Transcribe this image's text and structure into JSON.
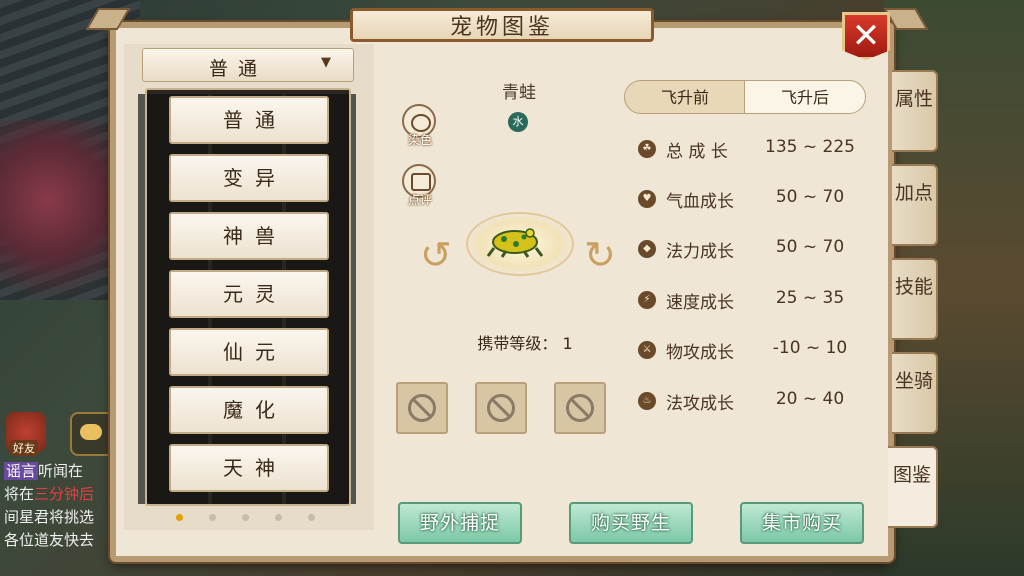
{
  "window": {
    "title": "宠物图鉴",
    "close_glyph": "✕"
  },
  "chat": {
    "friend_label": "好友",
    "lines": [
      {
        "tag": "谣言",
        "text": "听闻在"
      },
      {
        "pre": "将在",
        "red": "三分钟后"
      },
      {
        "text": "间星君将挑选"
      },
      {
        "text": "各位道友快去"
      }
    ]
  },
  "category": {
    "selected": "普通",
    "arrow": "▼",
    "options": [
      "普通",
      "变异",
      "神兽",
      "元灵",
      "仙元",
      "魔化",
      "天神"
    ]
  },
  "pet": {
    "name": "青蛙",
    "element": "水",
    "dye_label": "染色",
    "review_label": "点评",
    "carry_level_label": "携带等级：",
    "carry_level": "1"
  },
  "ascension_tabs": {
    "before": "飞升前",
    "after": "飞升后",
    "active": "before"
  },
  "stats": [
    {
      "name": "总 成 长",
      "value": "135 ~ 225",
      "icon": "growth-icon"
    },
    {
      "name": "气血成长",
      "value": "50 ~ 70",
      "icon": "heart-icon"
    },
    {
      "name": "法力成长",
      "value": "50 ~ 70",
      "icon": "mana-drop-icon"
    },
    {
      "name": "速度成长",
      "value": "25 ~ 35",
      "icon": "lightning-icon"
    },
    {
      "name": "物攻成长",
      "value": "-10 ~ 10",
      "icon": "sword-icon"
    },
    {
      "name": "法攻成长",
      "value": "20 ~ 40",
      "icon": "flame-icon"
    }
  ],
  "actions": {
    "capture": "野外捕捉",
    "buy_wild": "购买野生",
    "market": "集市购买"
  },
  "side_tabs": [
    {
      "label": "属性"
    },
    {
      "label": "加点"
    },
    {
      "label": "技能"
    },
    {
      "label": "坐骑"
    },
    {
      "label": "图鉴"
    }
  ],
  "colors": {
    "accent_green": "#7cc8a6",
    "close_red": "#c0281c",
    "panel_bg": "#efe6d6",
    "frame": "#b59a72"
  }
}
